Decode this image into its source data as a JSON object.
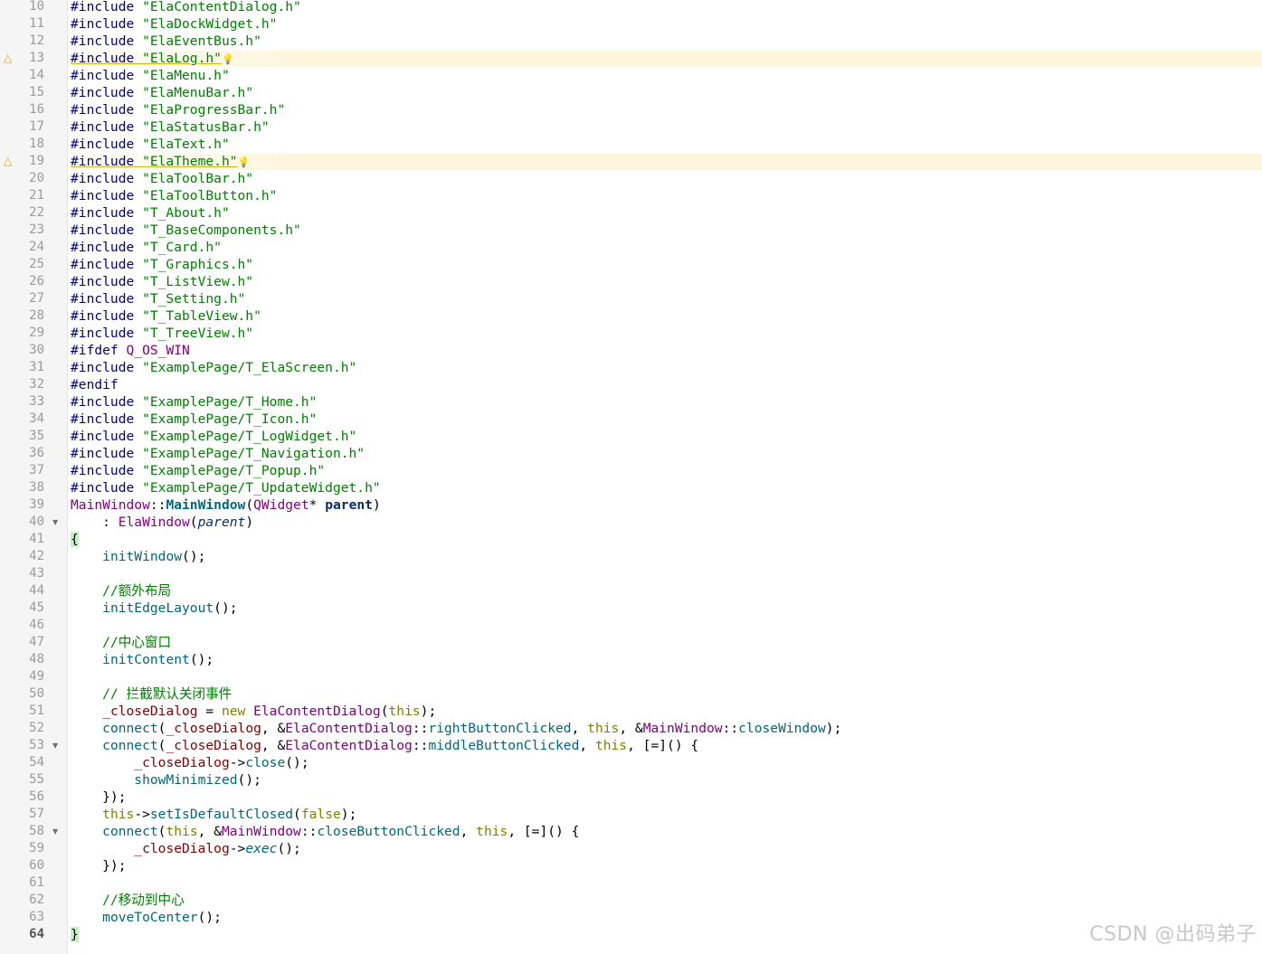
{
  "watermark": "CSDN @出码弟子",
  "lines": [
    {
      "n": "10",
      "tokens": [
        [
          "include",
          "#include "
        ],
        [
          "string",
          "\"ElaContentDialog.h\""
        ]
      ]
    },
    {
      "n": "11",
      "tokens": [
        [
          "include",
          "#include "
        ],
        [
          "string",
          "\"ElaDockWidget.h\""
        ]
      ]
    },
    {
      "n": "12",
      "tokens": [
        [
          "include",
          "#include "
        ],
        [
          "string",
          "\"ElaEventBus.h\""
        ]
      ]
    },
    {
      "n": "13",
      "warn": true,
      "tokens": [
        [
          "include",
          "#include "
        ],
        [
          "string",
          "\"ElaLog.h\""
        ]
      ]
    },
    {
      "n": "14",
      "tokens": [
        [
          "include",
          "#include "
        ],
        [
          "string",
          "\"ElaMenu.h\""
        ]
      ]
    },
    {
      "n": "15",
      "tokens": [
        [
          "include",
          "#include "
        ],
        [
          "string",
          "\"ElaMenuBar.h\""
        ]
      ]
    },
    {
      "n": "16",
      "tokens": [
        [
          "include",
          "#include "
        ],
        [
          "string",
          "\"ElaProgressBar.h\""
        ]
      ]
    },
    {
      "n": "17",
      "tokens": [
        [
          "include",
          "#include "
        ],
        [
          "string",
          "\"ElaStatusBar.h\""
        ]
      ]
    },
    {
      "n": "18",
      "tokens": [
        [
          "include",
          "#include "
        ],
        [
          "string",
          "\"ElaText.h\""
        ]
      ]
    },
    {
      "n": "19",
      "warn": true,
      "tokens": [
        [
          "include",
          "#include "
        ],
        [
          "string",
          "\"ElaTheme.h\""
        ]
      ]
    },
    {
      "n": "20",
      "tokens": [
        [
          "include",
          "#include "
        ],
        [
          "string",
          "\"ElaToolBar.h\""
        ]
      ]
    },
    {
      "n": "21",
      "tokens": [
        [
          "include",
          "#include "
        ],
        [
          "string",
          "\"ElaToolButton.h\""
        ]
      ]
    },
    {
      "n": "22",
      "tokens": [
        [
          "include",
          "#include "
        ],
        [
          "string",
          "\"T_About.h\""
        ]
      ]
    },
    {
      "n": "23",
      "tokens": [
        [
          "include",
          "#include "
        ],
        [
          "string",
          "\"T_BaseComponents.h\""
        ]
      ]
    },
    {
      "n": "24",
      "tokens": [
        [
          "include",
          "#include "
        ],
        [
          "string",
          "\"T_Card.h\""
        ]
      ]
    },
    {
      "n": "25",
      "tokens": [
        [
          "include",
          "#include "
        ],
        [
          "string",
          "\"T_Graphics.h\""
        ]
      ]
    },
    {
      "n": "26",
      "tokens": [
        [
          "include",
          "#include "
        ],
        [
          "string",
          "\"T_ListView.h\""
        ]
      ]
    },
    {
      "n": "27",
      "tokens": [
        [
          "include",
          "#include "
        ],
        [
          "string",
          "\"T_Setting.h\""
        ]
      ]
    },
    {
      "n": "28",
      "tokens": [
        [
          "include",
          "#include "
        ],
        [
          "string",
          "\"T_TableView.h\""
        ]
      ]
    },
    {
      "n": "29",
      "tokens": [
        [
          "include",
          "#include "
        ],
        [
          "string",
          "\"T_TreeView.h\""
        ]
      ]
    },
    {
      "n": "30",
      "tokens": [
        [
          "include",
          "#ifdef "
        ],
        [
          "macro",
          "Q_OS_WIN"
        ]
      ]
    },
    {
      "n": "31",
      "tokens": [
        [
          "include",
          "#include "
        ],
        [
          "string",
          "\"ExamplePage/T_ElaScreen.h\""
        ]
      ]
    },
    {
      "n": "32",
      "tokens": [
        [
          "include",
          "#endif"
        ]
      ]
    },
    {
      "n": "33",
      "tokens": [
        [
          "include",
          "#include "
        ],
        [
          "string",
          "\"ExamplePage/T_Home.h\""
        ]
      ]
    },
    {
      "n": "34",
      "tokens": [
        [
          "include",
          "#include "
        ],
        [
          "string",
          "\"ExamplePage/T_Icon.h\""
        ]
      ]
    },
    {
      "n": "35",
      "tokens": [
        [
          "include",
          "#include "
        ],
        [
          "string",
          "\"ExamplePage/T_LogWidget.h\""
        ]
      ]
    },
    {
      "n": "36",
      "tokens": [
        [
          "include",
          "#include "
        ],
        [
          "string",
          "\"ExamplePage/T_Navigation.h\""
        ]
      ]
    },
    {
      "n": "37",
      "tokens": [
        [
          "include",
          "#include "
        ],
        [
          "string",
          "\"ExamplePage/T_Popup.h\""
        ]
      ]
    },
    {
      "n": "38",
      "tokens": [
        [
          "include",
          "#include "
        ],
        [
          "string",
          "\"ExamplePage/T_UpdateWidget.h\""
        ]
      ]
    },
    {
      "n": "39",
      "tokens": [
        [
          "class",
          "MainWindow"
        ],
        [
          "plain",
          "::"
        ],
        [
          "method",
          "MainWindow"
        ],
        [
          "plain",
          "("
        ],
        [
          "class",
          "QWidget"
        ],
        [
          "plain",
          "* "
        ],
        [
          "param",
          "parent"
        ],
        [
          "plain",
          ")"
        ]
      ]
    },
    {
      "n": "40",
      "fold": true,
      "tokens": [
        [
          "plain",
          "    : "
        ],
        [
          "class",
          "ElaWindow"
        ],
        [
          "plain",
          "("
        ],
        [
          "param-i",
          "parent"
        ],
        [
          "plain",
          ")"
        ]
      ]
    },
    {
      "n": "41",
      "tokens": [
        [
          "brace",
          "{"
        ]
      ]
    },
    {
      "n": "42",
      "tokens": [
        [
          "plain",
          "    "
        ],
        [
          "call",
          "initWindow"
        ],
        [
          "plain",
          "();"
        ]
      ]
    },
    {
      "n": "43",
      "tokens": []
    },
    {
      "n": "44",
      "tokens": [
        [
          "comment",
          "    //额外布局"
        ]
      ]
    },
    {
      "n": "45",
      "tokens": [
        [
          "plain",
          "    "
        ],
        [
          "call",
          "initEdgeLayout"
        ],
        [
          "plain",
          "();"
        ]
      ]
    },
    {
      "n": "46",
      "tokens": []
    },
    {
      "n": "47",
      "tokens": [
        [
          "comment",
          "    //中心窗口"
        ]
      ]
    },
    {
      "n": "48",
      "tokens": [
        [
          "plain",
          "    "
        ],
        [
          "call",
          "initContent"
        ],
        [
          "plain",
          "();"
        ]
      ]
    },
    {
      "n": "49",
      "tokens": []
    },
    {
      "n": "50",
      "tokens": [
        [
          "comment",
          "    // 拦截默认关闭事件"
        ]
      ]
    },
    {
      "n": "51",
      "tokens": [
        [
          "plain",
          "    "
        ],
        [
          "member",
          "_closeDialog"
        ],
        [
          "plain",
          " = "
        ],
        [
          "kw",
          "new "
        ],
        [
          "class",
          "ElaContentDialog"
        ],
        [
          "plain",
          "("
        ],
        [
          "kw",
          "this"
        ],
        [
          "plain",
          ");"
        ]
      ]
    },
    {
      "n": "52",
      "tokens": [
        [
          "plain",
          "    "
        ],
        [
          "call",
          "connect"
        ],
        [
          "plain",
          "("
        ],
        [
          "member",
          "_closeDialog"
        ],
        [
          "plain",
          ", &"
        ],
        [
          "class",
          "ElaContentDialog"
        ],
        [
          "plain",
          "::"
        ],
        [
          "call",
          "rightButtonClicked"
        ],
        [
          "plain",
          ", "
        ],
        [
          "kw",
          "this"
        ],
        [
          "plain",
          ", &"
        ],
        [
          "class",
          "MainWindow"
        ],
        [
          "plain",
          "::"
        ],
        [
          "call",
          "closeWindow"
        ],
        [
          "plain",
          ");"
        ]
      ]
    },
    {
      "n": "53",
      "fold": true,
      "tokens": [
        [
          "plain",
          "    "
        ],
        [
          "call",
          "connect"
        ],
        [
          "plain",
          "("
        ],
        [
          "member",
          "_closeDialog"
        ],
        [
          "plain",
          ", &"
        ],
        [
          "class",
          "ElaContentDialog"
        ],
        [
          "plain",
          "::"
        ],
        [
          "call",
          "middleButtonClicked"
        ],
        [
          "plain",
          ", "
        ],
        [
          "kw",
          "this"
        ],
        [
          "plain",
          ", [=]() {"
        ]
      ]
    },
    {
      "n": "54",
      "tokens": [
        [
          "plain",
          "        "
        ],
        [
          "member",
          "_closeDialog"
        ],
        [
          "plain",
          "->"
        ],
        [
          "call",
          "close"
        ],
        [
          "plain",
          "();"
        ]
      ]
    },
    {
      "n": "55",
      "tokens": [
        [
          "plain",
          "        "
        ],
        [
          "call",
          "showMinimized"
        ],
        [
          "plain",
          "();"
        ]
      ]
    },
    {
      "n": "56",
      "tokens": [
        [
          "plain",
          "    });"
        ]
      ]
    },
    {
      "n": "57",
      "tokens": [
        [
          "plain",
          "    "
        ],
        [
          "kw",
          "this"
        ],
        [
          "plain",
          "->"
        ],
        [
          "call",
          "setIsDefaultClosed"
        ],
        [
          "plain",
          "("
        ],
        [
          "kw",
          "false"
        ],
        [
          "plain",
          ");"
        ]
      ]
    },
    {
      "n": "58",
      "fold": true,
      "tokens": [
        [
          "plain",
          "    "
        ],
        [
          "call",
          "connect"
        ],
        [
          "plain",
          "("
        ],
        [
          "kw",
          "this"
        ],
        [
          "plain",
          ", &"
        ],
        [
          "class",
          "MainWindow"
        ],
        [
          "plain",
          "::"
        ],
        [
          "call",
          "closeButtonClicked"
        ],
        [
          "plain",
          ", "
        ],
        [
          "kw",
          "this"
        ],
        [
          "plain",
          ", [=]() {"
        ]
      ]
    },
    {
      "n": "59",
      "tokens": [
        [
          "plain",
          "        "
        ],
        [
          "member",
          "_closeDialog"
        ],
        [
          "plain",
          "->"
        ],
        [
          "italic",
          "exec"
        ],
        [
          "plain",
          "();"
        ]
      ]
    },
    {
      "n": "60",
      "tokens": [
        [
          "plain",
          "    });"
        ]
      ]
    },
    {
      "n": "61",
      "tokens": []
    },
    {
      "n": "62",
      "tokens": [
        [
          "comment",
          "    //移动到中心"
        ]
      ]
    },
    {
      "n": "63",
      "tokens": [
        [
          "plain",
          "    "
        ],
        [
          "call",
          "moveToCenter"
        ],
        [
          "plain",
          "();"
        ]
      ]
    },
    {
      "n": "64",
      "current": true,
      "tokens": [
        [
          "brace",
          "}"
        ]
      ]
    }
  ]
}
